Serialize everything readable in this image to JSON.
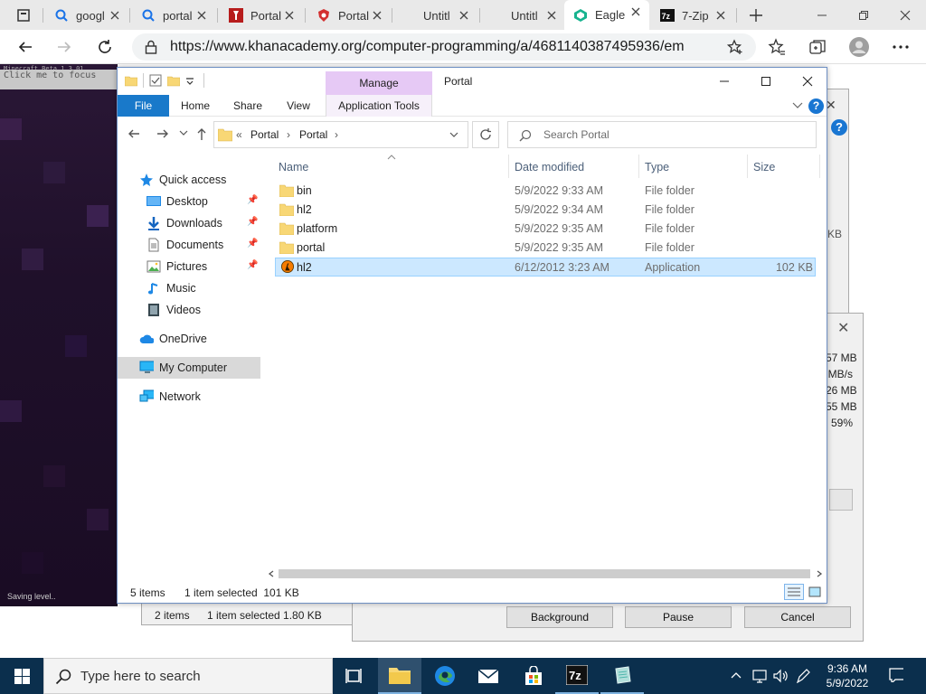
{
  "browser": {
    "tabs": [
      {
        "label": "googl",
        "icon": "search-icon"
      },
      {
        "label": "portal",
        "icon": "search-icon"
      },
      {
        "label": "Portal",
        "icon": "wrench-icon"
      },
      {
        "label": "Portal",
        "icon": "shield-icon"
      },
      {
        "label": "Untitl",
        "icon": ""
      },
      {
        "label": "Untitl",
        "icon": ""
      },
      {
        "label": "Eagle",
        "icon": "eagle-icon"
      },
      {
        "label": "7-Zip",
        "icon": "7zip-icon"
      }
    ],
    "url": "https://www.khanacademy.org/computer-programming/a/4681140387495936/em..."
  },
  "game": {
    "title_text": "Minecraft Beta 1.3_01",
    "click_text": "Click me to focus",
    "status_text": "Saving level.."
  },
  "zip_main": {
    "kb_text": "KB",
    "status_items": "2 items",
    "status_selected": "1 item selected  1.80 KB"
  },
  "zip_progress": {
    "values": [
      "57 MB",
      "MB/s",
      "26 MB",
      "55 MB",
      "59%"
    ],
    "background_label": "Background",
    "pause_label": "Pause",
    "cancel_label": "Cancel"
  },
  "explorer": {
    "manage_label": "Manage",
    "window_title": "Portal",
    "ribbon_tabs": {
      "file": "File",
      "home": "Home",
      "share": "Share",
      "view": "View",
      "app_tools": "Application Tools"
    },
    "address_crumbs": [
      "«",
      "Portal",
      "›",
      "Portal",
      "›"
    ],
    "search_placeholder": "Search Portal",
    "nav_items": [
      {
        "label": "Quick access",
        "icon": "star-icon",
        "pinned": false
      },
      {
        "label": "Desktop",
        "icon": "desktop-icon",
        "pinned": true
      },
      {
        "label": "Downloads",
        "icon": "download-icon",
        "pinned": true
      },
      {
        "label": "Documents",
        "icon": "documents-icon",
        "pinned": true
      },
      {
        "label": "Pictures",
        "icon": "pictures-icon",
        "pinned": true
      },
      {
        "label": "Music",
        "icon": "music-icon",
        "pinned": false
      },
      {
        "label": "Videos",
        "icon": "videos-icon",
        "pinned": false
      },
      {
        "label": "OneDrive",
        "icon": "cloud-icon",
        "pinned": false
      },
      {
        "label": "My Computer",
        "icon": "computer-icon",
        "pinned": false
      },
      {
        "label": "Network",
        "icon": "network-icon",
        "pinned": false
      }
    ],
    "columns": {
      "name": "Name",
      "date": "Date modified",
      "type": "Type",
      "size": "Size"
    },
    "files": [
      {
        "name": "bin",
        "date": "5/9/2022 9:33 AM",
        "type": "File folder",
        "size": "",
        "icon": "folder-icon"
      },
      {
        "name": "hl2",
        "date": "5/9/2022 9:34 AM",
        "type": "File folder",
        "size": "",
        "icon": "folder-icon"
      },
      {
        "name": "platform",
        "date": "5/9/2022 9:35 AM",
        "type": "File folder",
        "size": "",
        "icon": "folder-icon"
      },
      {
        "name": "portal",
        "date": "5/9/2022 9:35 AM",
        "type": "File folder",
        "size": "",
        "icon": "folder-icon"
      },
      {
        "name": "hl2",
        "date": "6/12/2012 3:23 AM",
        "type": "Application",
        "size": "102 KB",
        "icon": "half-life-icon",
        "selected": true
      }
    ],
    "status_items": "5 items",
    "status_selected": "1 item selected  101 KB"
  },
  "taskbar": {
    "search_placeholder": "Type here to search",
    "time": "9:36 AM",
    "date": "5/9/2022"
  },
  "colors": {
    "accent": "#1979ca",
    "selection": "#cce8ff",
    "manage_tab": "#e6c9f5",
    "taskbar": "#0b2f4d"
  }
}
